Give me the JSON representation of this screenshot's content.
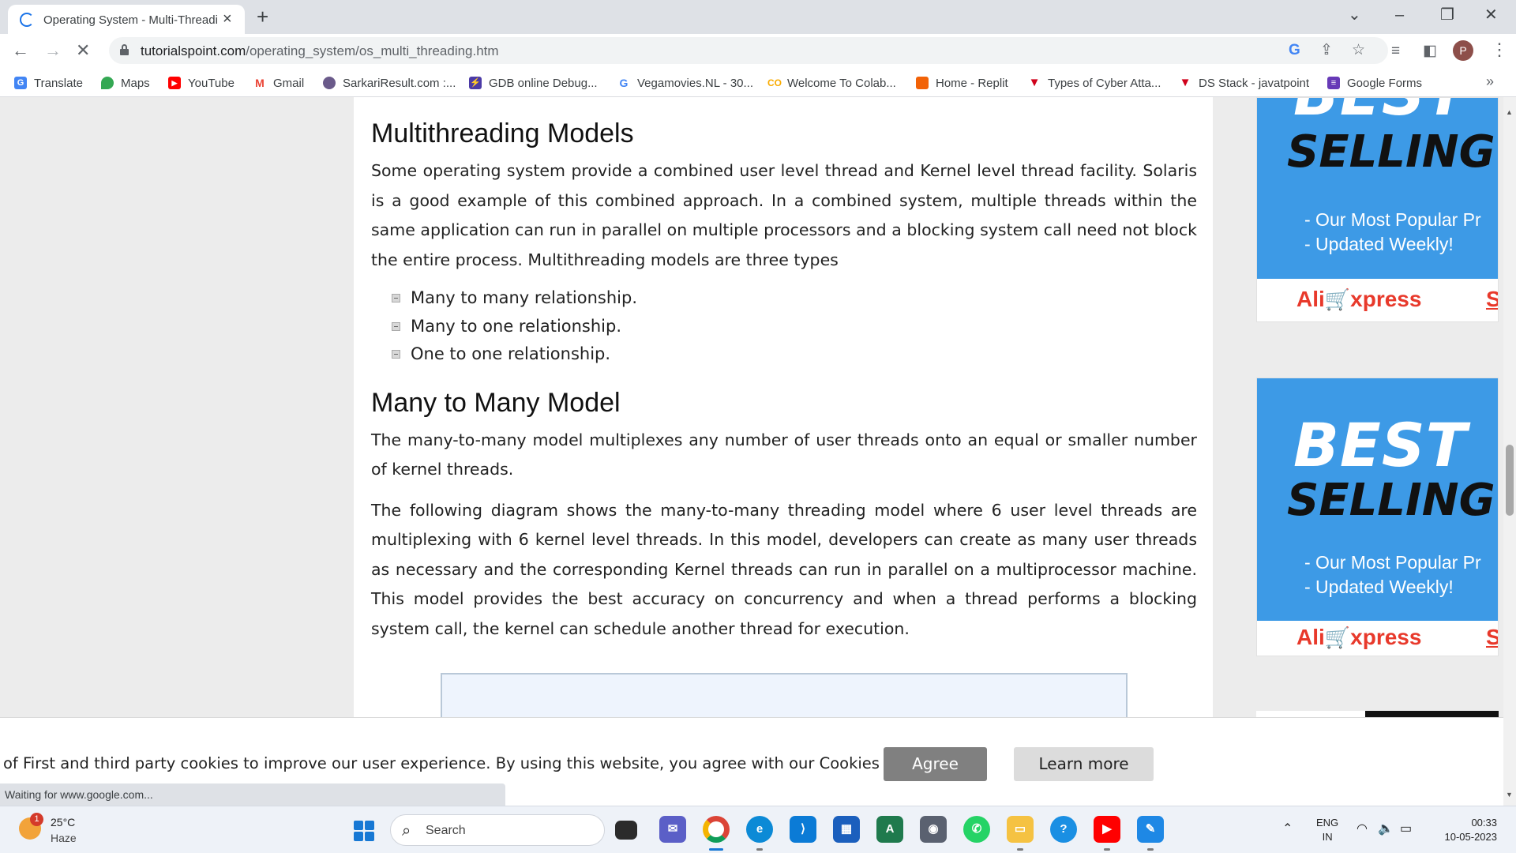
{
  "browser": {
    "tab_title": "Operating System - Multi-Threading",
    "tab_close": "×",
    "new_tab": "+",
    "url_host": "tutorialspoint.com",
    "url_path": "/operating_system/os_multi_threading.htm",
    "profile_initial": "P",
    "status_text": "Waiting for www.google.com..."
  },
  "bookmarks": [
    {
      "label": "Translate",
      "icon": "translate-icon",
      "color": "#4285f4"
    },
    {
      "label": "Maps",
      "icon": "maps-icon",
      "color": "#34a853"
    },
    {
      "label": "YouTube",
      "icon": "youtube-icon",
      "color": "#ff0000"
    },
    {
      "label": "Gmail",
      "icon": "gmail-icon",
      "color": "#ea4335"
    },
    {
      "label": "SarkariResult.com :...",
      "icon": "sarkariresult-icon",
      "color": "#6a5a8a"
    },
    {
      "label": "GDB online Debug...",
      "icon": "gdb-icon",
      "color": "#4b3aa6"
    },
    {
      "label": "Vegamovies.NL - 30...",
      "icon": "google-icon",
      "color": "#4285f4"
    },
    {
      "label": "Welcome To Colab...",
      "icon": "colab-icon",
      "color": "#f9ab00"
    },
    {
      "label": "Home - Replit",
      "icon": "replit-icon",
      "color": "#f26207"
    },
    {
      "label": "Types of Cyber Atta...",
      "icon": "javatpoint-icon",
      "color": "#d0021b"
    },
    {
      "label": "DS Stack - javatpoint",
      "icon": "javatpoint-icon",
      "color": "#d0021b"
    },
    {
      "label": "Google Forms",
      "icon": "google-forms-icon",
      "color": "#673ab7"
    }
  ],
  "article": {
    "heading1": "Multithreading Models",
    "para1": "Some operating system provide a combined user level thread and Kernel level thread facility. Solaris is a good example of this combined approach. In a combined system, multiple threads within the same application can run in parallel on multiple processors and a blocking system call need not block the entire process. Multithreading models are three types",
    "list": [
      "Many to many relationship.",
      "Many to one relationship.",
      "One to one relationship."
    ],
    "heading2": "Many to Many Model",
    "para2": "The many-to-many model multiplexes any number of user threads onto an equal or smaller number of kernel threads.",
    "para3": "The following diagram shows the many-to-many threading model where 6 user level threads are multiplexing with 6 kernel level threads. In this model, developers can create as many user threads as necessary and the corresponding Kernel threads can run in parallel on a multiprocessor machine. This model provides the best accuracy on concurrency and when a thread performs a blocking system call, the kernel can schedule another thread for execution."
  },
  "ads": {
    "ad1": {
      "best": "BEST",
      "selling": "SELLING",
      "line1": "- Our Most Popular Pr",
      "line2": "- Updated Weekly!",
      "logo_left": "Ali",
      "logo_right": "xpress",
      "s": "S"
    },
    "ad2": {
      "best": "BEST",
      "selling": "SELLING",
      "line1": "- Our Most Popular Pr",
      "line2": "- Updated Weekly!",
      "logo_left": "Ali",
      "logo_right": "xpress",
      "s": "S"
    }
  },
  "cookie": {
    "text": "of First and third party cookies to improve our user experience. By using this website, you agree with our Cookies Policy.",
    "agree": "Agree",
    "learn_more": "Learn more"
  },
  "taskbar": {
    "badge": "1",
    "temp": "25°C",
    "weather": "Haze",
    "search": "Search",
    "lang1": "ENG",
    "lang2": "IN",
    "time": "00:33",
    "date": "10-05-2023"
  }
}
